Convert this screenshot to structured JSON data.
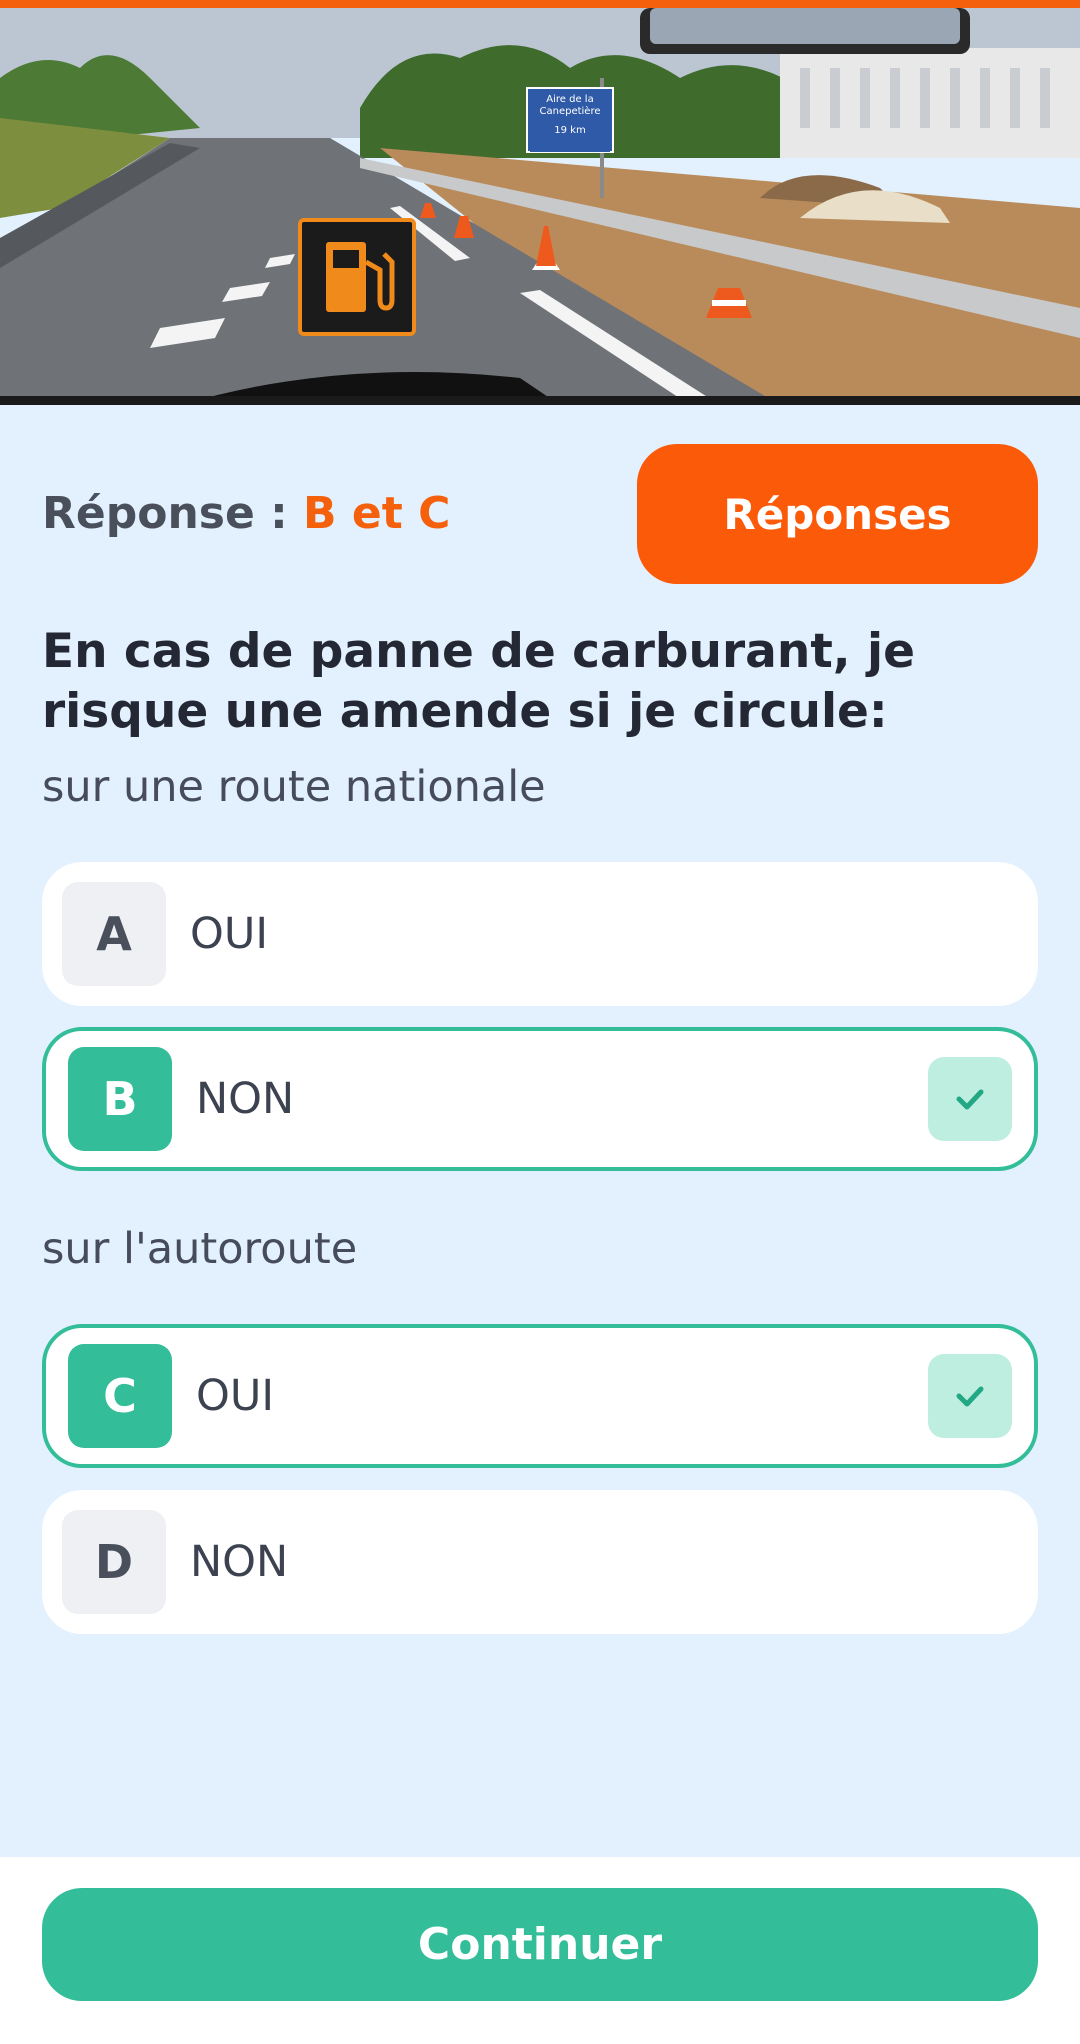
{
  "colors": {
    "accent": "#f4600c",
    "answers_button": "#fb5a08",
    "correct": "#33bd98",
    "background": "#e2f1fd"
  },
  "image": {
    "description_icons": [
      "fuel-warning-icon",
      "road-scene-image"
    ],
    "road_sign": {
      "line1": "Aire de la",
      "line2": "Canepetière",
      "distance": "19 km"
    }
  },
  "answer": {
    "label": "Réponse : ",
    "value": "B et C",
    "button_label": "Réponses"
  },
  "question": {
    "text": "En cas de panne de carburant, je risque une amende si je circule:",
    "groups": [
      {
        "label": "sur une route nationale",
        "options": [
          {
            "letter": "A",
            "text": "OUI",
            "selected": false
          },
          {
            "letter": "B",
            "text": "NON",
            "selected": true,
            "icon": "check-icon"
          }
        ]
      },
      {
        "label": "sur l'autoroute",
        "options": [
          {
            "letter": "C",
            "text": "OUI",
            "selected": true,
            "icon": "check-icon"
          },
          {
            "letter": "D",
            "text": "NON",
            "selected": false
          }
        ]
      }
    ]
  },
  "footer": {
    "continue_label": "Continuer"
  }
}
